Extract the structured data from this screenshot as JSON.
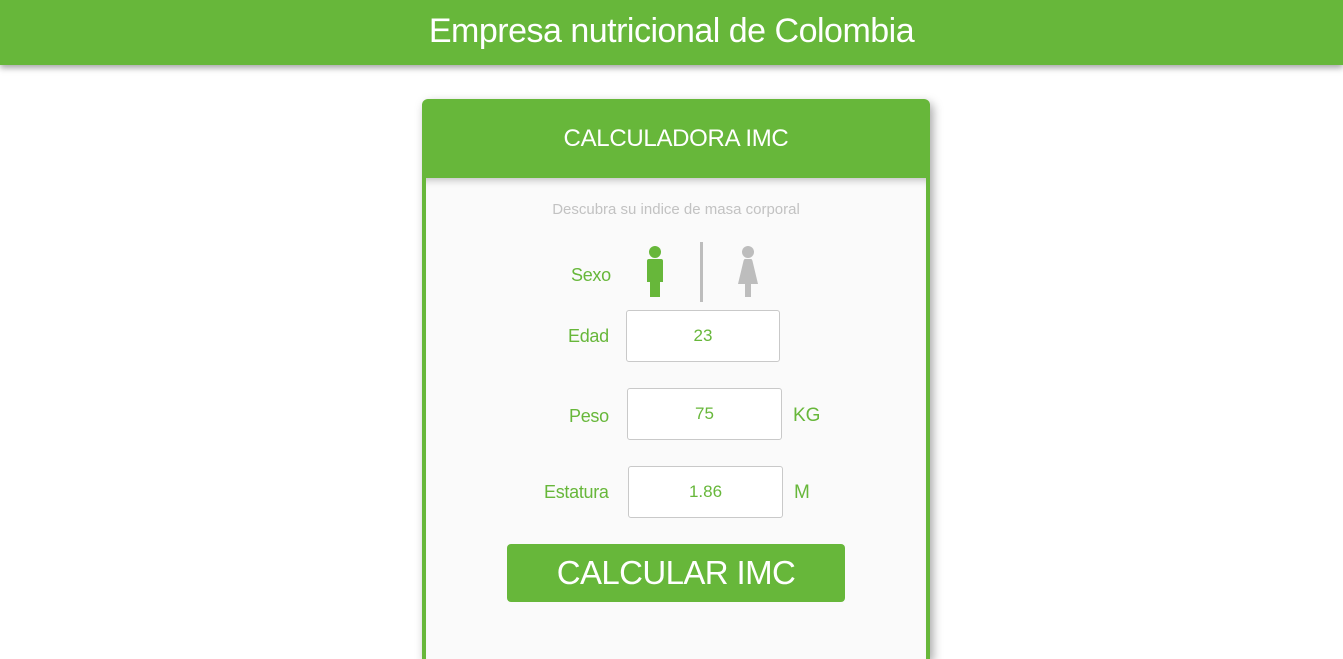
{
  "header": {
    "title": "Empresa nutricional de Colombia"
  },
  "calculator": {
    "title": "CALCULADORA IMC",
    "subtitle": "Descubra su indice de masa corporal",
    "sex": {
      "label": "Sexo",
      "options": [
        "male-icon",
        "female-icon"
      ],
      "selected": "male"
    },
    "age": {
      "label": "Edad",
      "value": "23"
    },
    "weight": {
      "label": "Peso",
      "value": "75",
      "unit": "KG"
    },
    "height": {
      "label": "Estatura",
      "value": "1.86",
      "unit": "M"
    },
    "submit_label": "CALCULAR IMC"
  },
  "colors": {
    "accent": "#67b73a",
    "muted": "#bdbdbd",
    "background": "#fafafa"
  }
}
